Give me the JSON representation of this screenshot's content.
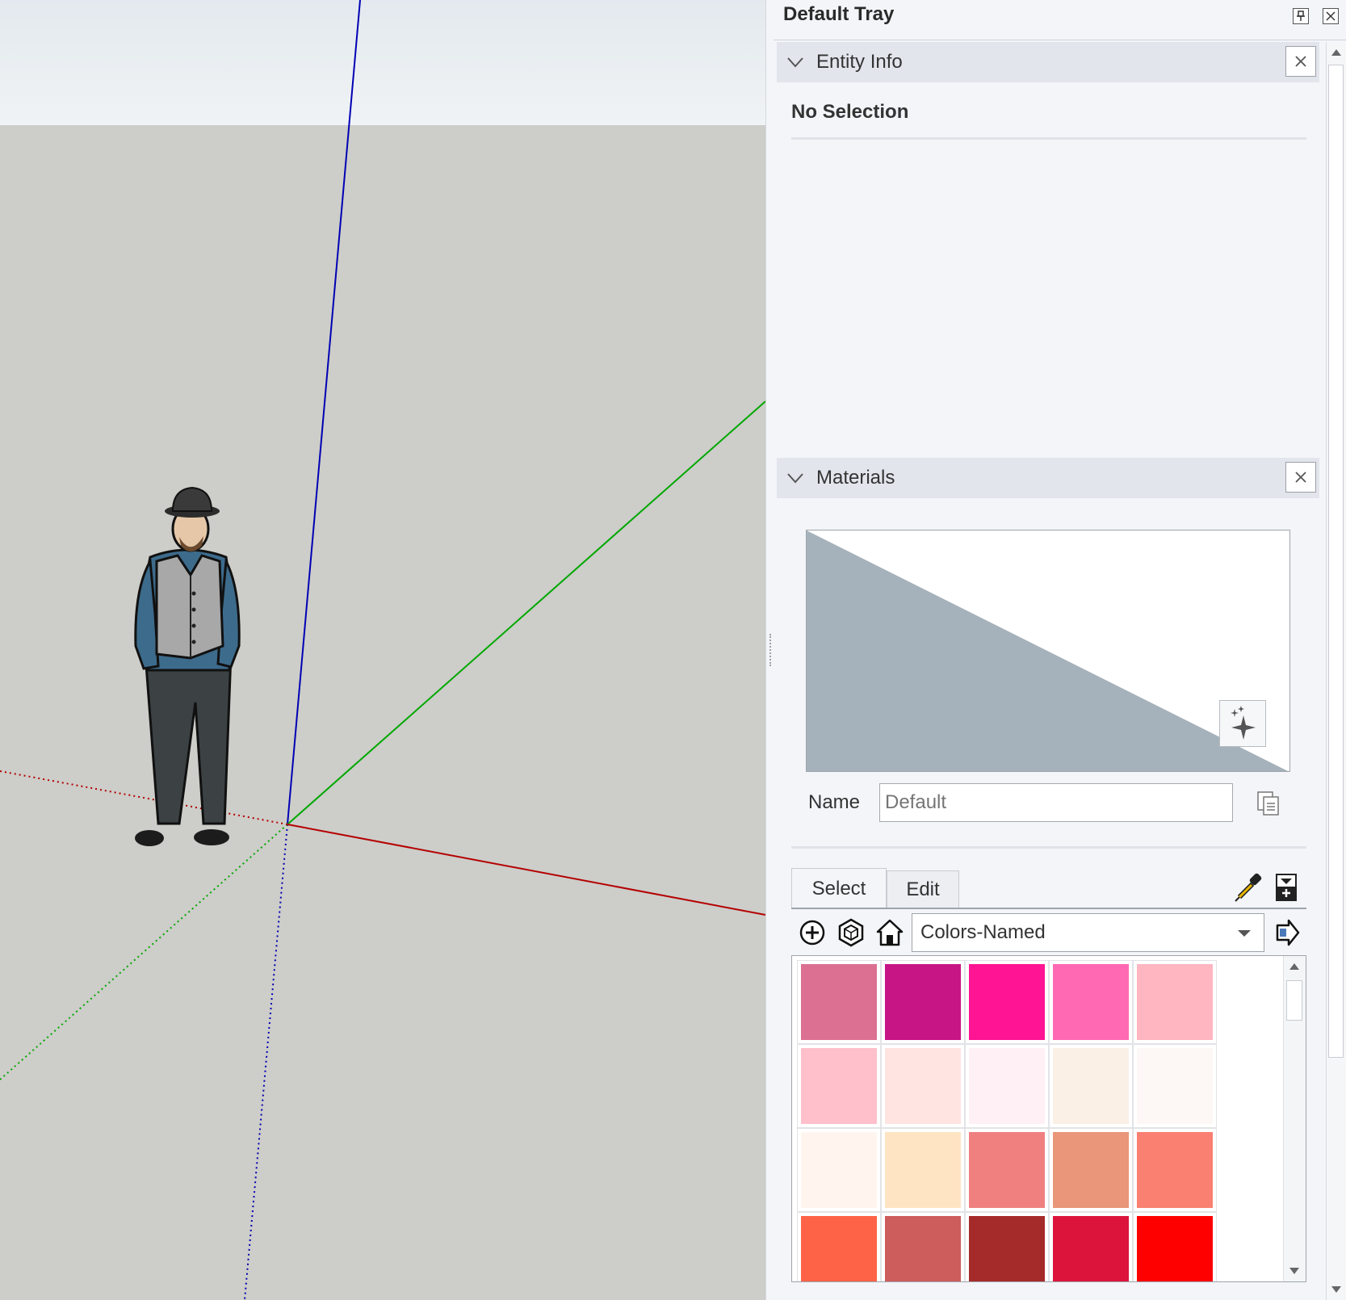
{
  "tray": {
    "title": "Default Tray",
    "pin_icon": "pin-icon",
    "close_icon": "close-icon"
  },
  "entity_info": {
    "title": "Entity Info",
    "selection_status": "No Selection"
  },
  "materials": {
    "title": "Materials",
    "name_label": "Name",
    "name_placeholder": "Default",
    "tabs": [
      {
        "label": "Select",
        "active": true
      },
      {
        "label": "Edit",
        "active": false
      }
    ],
    "library": "Colors-Named",
    "preview_color": "#a5b2bb",
    "swatches": [
      "#db7093",
      "#c71585",
      "#ff1493",
      "#ff69b4",
      "#ffb6c1",
      "#ffc0cb",
      "#ffe4e1",
      "#fff0f5",
      "#faf0e6",
      "#fdf8f6",
      "#fff5ee",
      "#ffe4c4",
      "#f08080",
      "#e9967a",
      "#fa8072",
      "#ff6347",
      "#cd5c5c",
      "#a52a2a",
      "#dc143c",
      "#ff0000"
    ]
  },
  "scene": {
    "axis_colors": {
      "red": "#c00000",
      "green": "#00b000",
      "blue": "#0000c0"
    }
  }
}
